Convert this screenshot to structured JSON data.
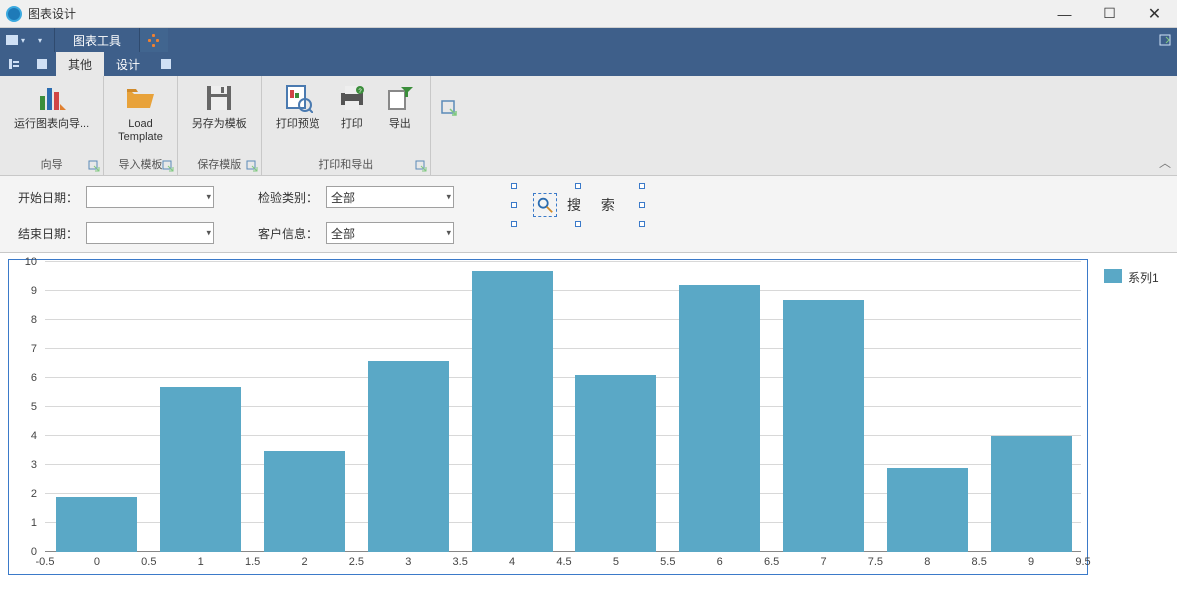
{
  "window": {
    "title": "图表设计",
    "min": "—",
    "max": "☐",
    "close": "✕"
  },
  "ribbon": {
    "context_title": "图表工具",
    "tabs": {
      "other": "其他",
      "design": "设计"
    },
    "groups": {
      "wizard": {
        "label": "向导",
        "run_wizard": "运行图表向导..."
      },
      "import": {
        "label": "导入模板",
        "load_template": "Load\nTemplate"
      },
      "save": {
        "label": "保存模版",
        "save_as": "另存为模板"
      },
      "print_export": {
        "label": "打印和导出",
        "preview": "打印预览",
        "print": "打印",
        "export": "导出"
      }
    }
  },
  "filters": {
    "start_date": "开始日期",
    "end_date": "结束日期",
    "test_type": "检验类别",
    "customer": "客户信息",
    "all": "全部",
    "search": "搜 索"
  },
  "legend": {
    "series1": "系列1"
  },
  "chart_data": {
    "type": "bar",
    "categories": [
      0,
      1,
      2,
      3,
      4,
      5,
      6,
      7,
      8,
      9
    ],
    "values": [
      1.9,
      5.7,
      3.5,
      6.6,
      9.7,
      6.1,
      9.2,
      8.7,
      2.9,
      4.0
    ],
    "x_ticks": [
      -0.5,
      0,
      0.5,
      1,
      1.5,
      2,
      2.5,
      3,
      3.5,
      4,
      4.5,
      5,
      5.5,
      6,
      6.5,
      7,
      7.5,
      8,
      8.5,
      9,
      9.5
    ],
    "y_ticks": [
      0,
      1,
      2,
      3,
      4,
      5,
      6,
      7,
      8,
      9,
      10
    ],
    "xlim": [
      -0.5,
      9.5
    ],
    "ylim": [
      0,
      10
    ],
    "series_name": "系列1"
  }
}
